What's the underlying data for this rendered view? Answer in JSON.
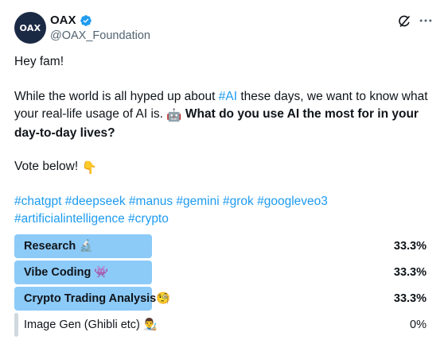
{
  "author": {
    "avatar_text": "OAX",
    "display_name": "OAX",
    "handle": "@OAX_Foundation",
    "verified": true
  },
  "icons": {
    "verified": "verified-badge-icon",
    "grok": "grok-icon",
    "more": "more-options-icon"
  },
  "text": {
    "greeting": "Hey fam!",
    "para_intro_a": "While the world is all hyped up about ",
    "para_intro_link": "#AI",
    "para_intro_b": " these days, we want to know what your real-life usage of AI is. ",
    "para_intro_emoji": "🤖",
    "para_question": "What do you use AI the most for in your day-to-day lives?",
    "vote_text": "Vote below! ",
    "vote_emoji": "👇"
  },
  "hashtags": [
    "#chatgpt",
    "#deepseek",
    "#manus",
    "#gemini",
    "#grok",
    "#googleveo3",
    "#artificialintelligence",
    "#crypto"
  ],
  "poll": {
    "options": [
      {
        "label": "Research 🔬",
        "percent_text": "33.3%",
        "fraction": 0.333,
        "leading": true
      },
      {
        "label": "Vibe Coding 👾",
        "percent_text": "33.3%",
        "fraction": 0.333,
        "leading": true
      },
      {
        "label": "Crypto Trading Analysis🧐",
        "percent_text": "33.3%",
        "fraction": 0.333,
        "leading": true
      },
      {
        "label": "Image Gen (Ghibli etc) 👨‍🎨",
        "percent_text": "0%",
        "fraction": 0,
        "leading": false
      }
    ]
  },
  "colors": {
    "link": "#1d9bf0",
    "poll_bar": "#8ccaf8",
    "poll_bar_empty": "#cfd9de",
    "text": "#0f1419",
    "muted": "#536471",
    "avatar_bg": "#1b2a44"
  }
}
